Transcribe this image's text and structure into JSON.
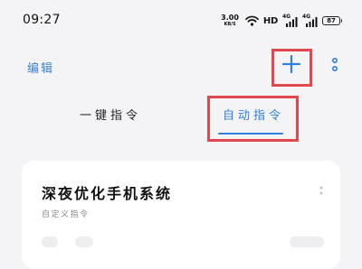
{
  "status_bar": {
    "time": "09:27",
    "net_speed_value": "3.00",
    "net_speed_unit": "KB/S",
    "hd_label": "HD",
    "signal_1_tag": "4G",
    "signal_2_tag": "4G",
    "battery_level": "87"
  },
  "toolbar": {
    "edit_label": "编辑",
    "add_icon": "plus-icon",
    "more_icon": "more-vertical-icon"
  },
  "tabs": {
    "items": [
      {
        "label": "一键指令",
        "active": false
      },
      {
        "label": "自动指令",
        "active": true
      }
    ]
  },
  "card": {
    "title": "深夜优化手机系统",
    "subtitle": "自定义指令"
  },
  "colors": {
    "accent": "#2d7fe0",
    "edit_text": "#3a7fd4",
    "highlight": "#e0484e",
    "background": "#f4f4f6"
  }
}
